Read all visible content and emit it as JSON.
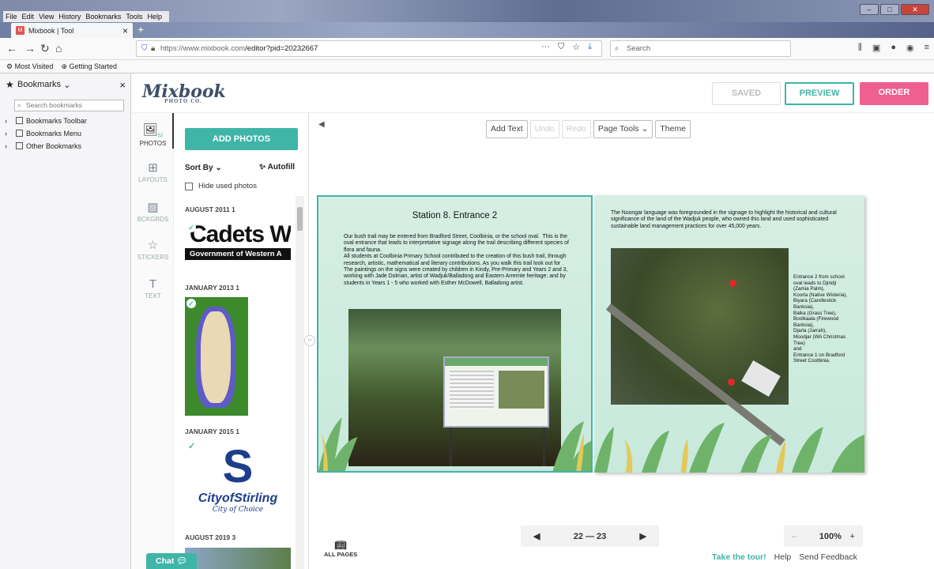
{
  "browser": {
    "menu": [
      "File",
      "Edit",
      "View",
      "History",
      "Bookmarks",
      "Tools",
      "Help"
    ],
    "tab_title": "Mixbook | Tool",
    "url_host": "https://www.mixbook.com",
    "url_path": "/editor?pid=20232667",
    "search_placeholder": "Search",
    "bookmarks_bar": [
      "Most Visited",
      "Getting Started"
    ]
  },
  "bookmarks_sidebar": {
    "title": "Bookmarks",
    "search_placeholder": "Search bookmarks",
    "items": [
      "Bookmarks Toolbar",
      "Bookmarks Menu",
      "Other Bookmarks"
    ]
  },
  "app": {
    "logo": "Mixbook",
    "logo_sub": "PHOTO CO.",
    "saved": "SAVED",
    "preview": "PREVIEW",
    "order": "ORDER"
  },
  "rail": [
    {
      "label": "PHOTOS",
      "icon": "photos-icon",
      "badge": "52"
    },
    {
      "label": "LAYOUTS",
      "icon": "layouts-icon"
    },
    {
      "label": "BCKGRDS",
      "icon": "backgrounds-icon"
    },
    {
      "label": "STICKERS",
      "icon": "stickers-icon"
    },
    {
      "label": "TEXT",
      "icon": "text-icon"
    }
  ],
  "photos_panel": {
    "add_photos": "ADD PHOTOS",
    "sort_by": "Sort By",
    "autofill": "Autofill",
    "hide_used": "Hide used photos",
    "groups": [
      {
        "label": "AUGUST 2011  1"
      },
      {
        "label": "JANUARY 2013  1"
      },
      {
        "label": "JANUARY 2015  1"
      },
      {
        "label": "AUGUST 2019  3"
      }
    ],
    "cadets_text": "Cadets W",
    "cadets_sub": "Government of Western A",
    "stirling_main": "CityofStirling",
    "stirling_sub": "City of Choice"
  },
  "toolbar": {
    "add_text": "Add Text",
    "undo": "Undo",
    "redo": "Redo",
    "page_tools": "Page Tools",
    "theme": "Theme"
  },
  "page_left": {
    "title": "Station 8. Entrance 2",
    "body": "Our bush trail may be entered from Bradford Street, Coolbinia, or the school oval.  This is the oval entrance that leads to interpretative signage along the trail describing different species of flora and fauna.\nAll students at Coolbinia Primary School contributed to the creation of this bush trail, through research, artistic, mathematical and literary contributions. As you walk this trail look out for . The paintings on the signs were created by children in Kindy, Pre-Primary and Years 2 and 3, working with Jade Dolman, artist of Wadjuk/Balladong and Eastern Arrernte heritage; and by students in Years 1 - 5 who worked with Esther McDowell, Balladong artist."
  },
  "page_right": {
    "body": "The Noongar language was foregrounded in the signage to highlight the historical and cultural significance of the land of the Wadjuk people, who owned this land and used sophisticated sustainable land management practices for over 45,000 years.",
    "caption": "Entrance 2 from school oval leads to Djiridji (Zamia Palm),\nKoorla (Native Wisteria),\nBiyara (Candlestick Banksia),\nBalka (Grass Tree),\nBoolkaala (Firewood Banksia),\nDjarla (Jarrah),\nMoodjar (WA Christmas Tree)\nand\nEntrance 1 on Bradford Street Coolbinia."
  },
  "footer": {
    "pages": "22 — 23",
    "zoom": "100%",
    "all_pages": "ALL PAGES",
    "tour": "Take the tour!",
    "help": "Help",
    "feedback": "Send Feedback",
    "chat": "Chat"
  },
  "colors": {
    "accent": "#3fb5a8",
    "order": "#ef5f8f",
    "page_bg": "#d6eee4"
  }
}
